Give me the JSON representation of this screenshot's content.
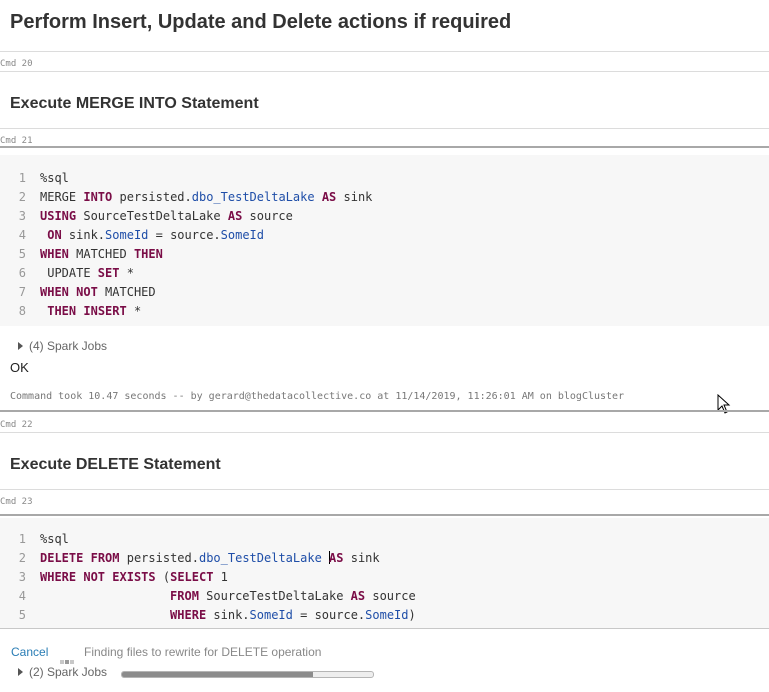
{
  "headings": {
    "main": "Perform Insert, Update and Delete actions if required",
    "merge": "Execute MERGE INTO Statement",
    "delete": "Execute DELETE Statement"
  },
  "cmd_labels": {
    "cmd20": "Cmd 20",
    "cmd21": "Cmd 21",
    "cmd22": "Cmd 22",
    "cmd23": "Cmd 23"
  },
  "merge_cell": {
    "line_numbers": [
      "1",
      "2",
      "3",
      "4",
      "5",
      "6",
      "7",
      "8"
    ],
    "jobs": "(4) Spark Jobs",
    "result": "OK",
    "command_took": "Command took 10.47 seconds -- by gerard@thedatacollective.co at 11/14/2019, 11:26:01 AM on blogCluster"
  },
  "delete_cell": {
    "line_numbers": [
      "1",
      "2",
      "3",
      "4",
      "5"
    ],
    "cancel": "Cancel",
    "status": "Finding files to rewrite for DELETE operation",
    "jobs": "(2) Spark Jobs",
    "progress": 0.76
  },
  "colors": {
    "keyword": "#7a0d47",
    "identifier": "#1f4ea8",
    "link": "#2a7db5"
  },
  "icons": [
    "expand-triangle-icon",
    "spinner-dots-icon",
    "mouse-cursor-icon"
  ]
}
